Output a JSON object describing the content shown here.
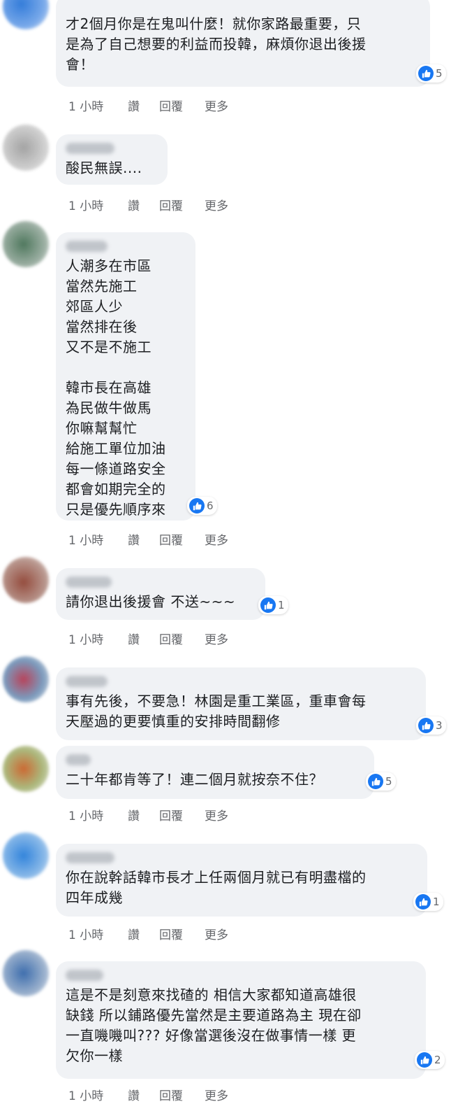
{
  "actions": {
    "time": "1 小時",
    "like": "讚",
    "reply": "回覆",
    "more": "更多"
  },
  "comments": [
    {
      "text": "才2個月你是在鬼叫什麼！就你家路最重要，只\n是為了自己想要的利益而投韓，麻煩你退出後援\n會！",
      "likes": "5"
    },
    {
      "text": "酸民無誤....",
      "likes": ""
    },
    {
      "text": "人潮多在市區\n當然先施工\n郊區人少\n當然排在後\n又不是不施工\n\n韓市長在高雄\n為民做牛做馬\n你嘛幫幫忙\n給施工單位加油\n每一條道路安全\n都會如期完全的\n只是優先順序來",
      "likes": "6"
    },
    {
      "text": "請你退出後援會 不送~~~",
      "likes": "1"
    },
    {
      "text": "事有先後，不要急！林園是重工業區，重車會每\n天壓過的更要慎重的安排時間翻修",
      "likes": "3"
    },
    {
      "text": "二十年都肯等了！連二個月就按奈不住？",
      "likes": "5"
    },
    {
      "text": "你在說幹話韓市長才上任兩個月就已有明盡檔的\n四年成幾",
      "likes": "1"
    },
    {
      "text": "這是不是刻意來找碴的 相信大家都知道高雄很\n缺錢 所以鋪路優先當然是主要道路為主 現在卻\n一直嘰嘰叫??? 好像當選後沒在做事情一樣 更\n欠你一樣",
      "likes": "2"
    }
  ],
  "colors": {
    "like_blue": "#1877f2",
    "bubble_bg": "#f0f2f5",
    "meta_gray": "#65676b"
  }
}
